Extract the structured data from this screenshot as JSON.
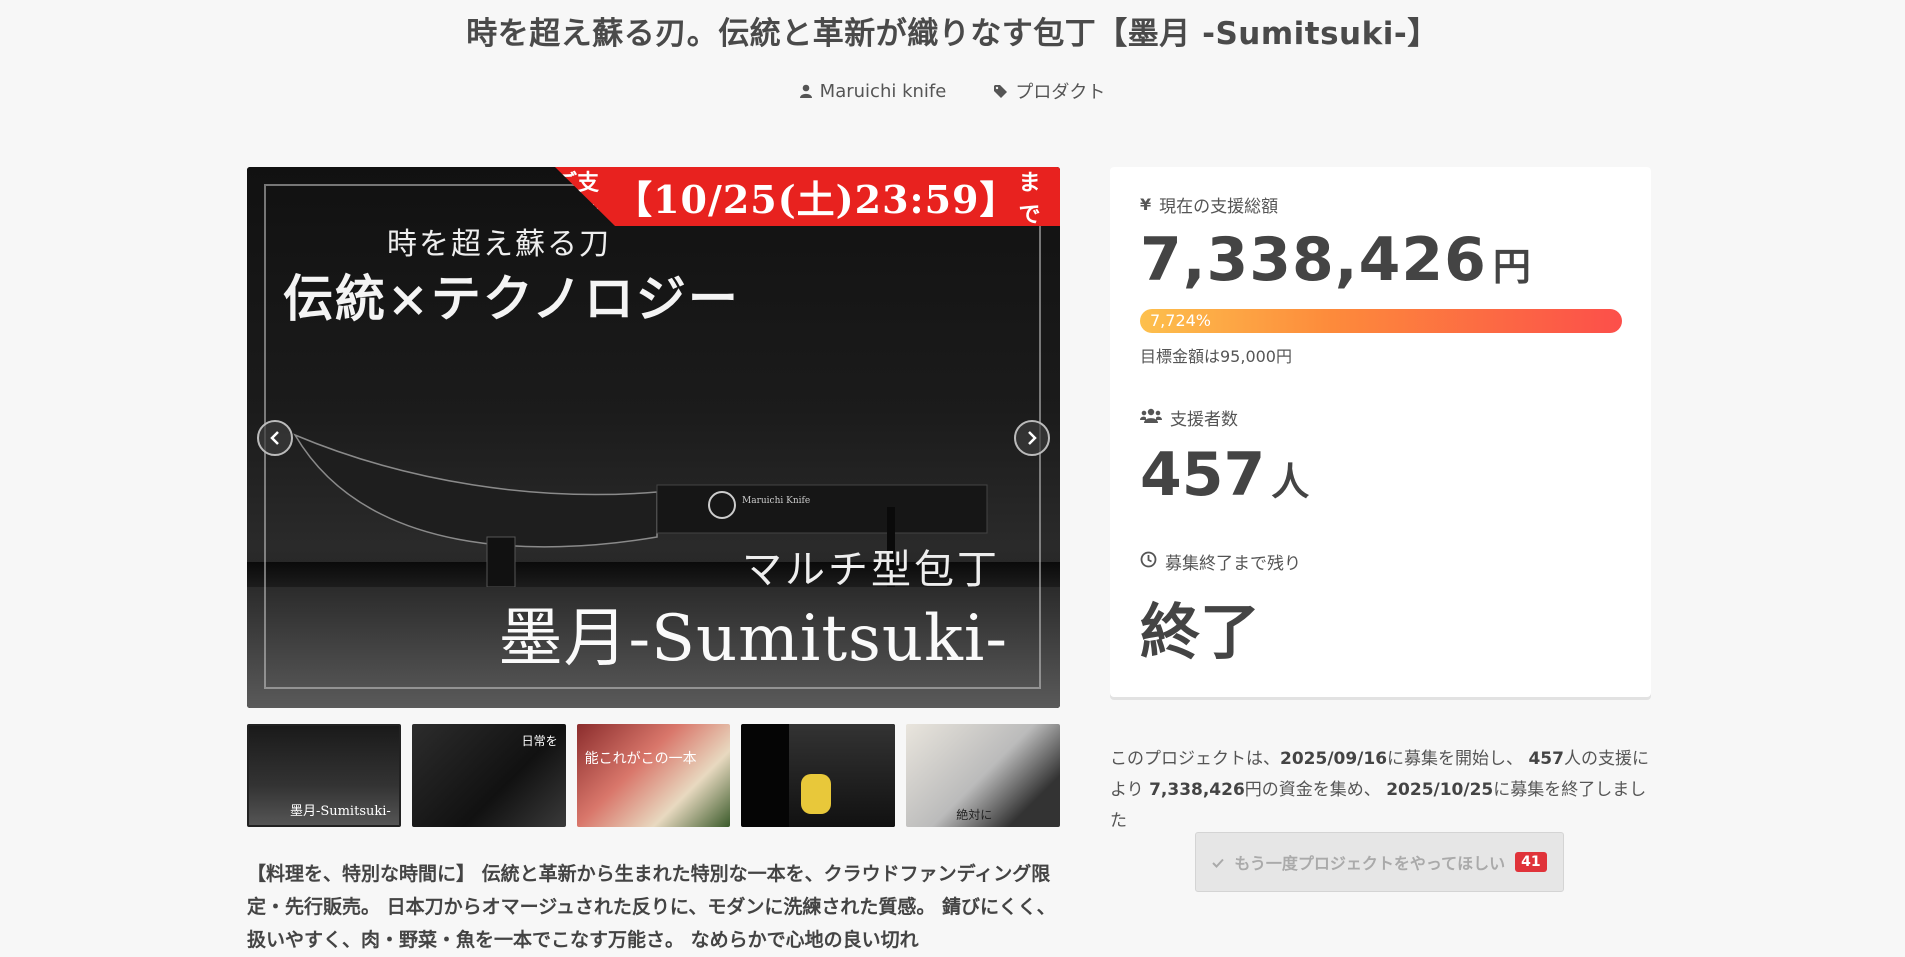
{
  "project": {
    "title": "時を超え蘇る刃。伝統と革新が織りなす包丁【墨月 -Sumitsuki-】",
    "owner": "Maruichi knife",
    "category": "プロダクト"
  },
  "main_image": {
    "banner_prefix": "ご支援は",
    "banner_date": "【10/25(土)23:59】",
    "banner_suffix": "まで",
    "line1": "時を超え蘇る刀",
    "line2": "伝統×テクノロジー",
    "line3": "マルチ型包丁",
    "line4": "墨月-Sumitsuki-",
    "knife_brand": "Maruichi Knife"
  },
  "thumbnails": [
    {
      "caption": "墨月-Sumitsuki-"
    },
    {
      "caption": "日常を"
    },
    {
      "caption": "能これがこの一本"
    },
    {
      "caption": ""
    },
    {
      "caption": "絶対に"
    }
  ],
  "description": "【料理を、特別な時間に】 伝統と革新から生まれた特別な一本を、クラウドファンディング限定・先行販売。 日本刀からオマージュされた反りに、モダンに洗練された質感。 錆びにくく、扱いやすく、肉・野菜・魚を一本でこなす万能さ。 なめらかで心地の良い切れ",
  "panel": {
    "raised_label": "現在の支援総額",
    "raised_amount": "7,338,426",
    "raised_unit": "円",
    "progress_percent": "7,724%",
    "progress_fraction": 1.0,
    "goal_text": "目標金額は95,000円",
    "backers_label": "支援者数",
    "backers_count": "457",
    "backers_unit": "人",
    "time_label": "募集終了まで残り",
    "time_value": "終了"
  },
  "summary": {
    "p1": "このプロジェクトは、",
    "start_date": "2025/09/16",
    "p2": "に募集を開始し、 ",
    "backers": "457",
    "p3": "人の支援により ",
    "amount": "7,338,426",
    "p4": "円の資金を集め、 ",
    "end_date": "2025/10/25",
    "p5": "に募集を終了しました"
  },
  "again_button": {
    "label": "もう一度プロジェクトをやってほしい",
    "count": "41"
  },
  "colors": {
    "accent_red": "#e8221f",
    "progress_start": "#fdc04d",
    "progress_end": "#fc4f4a",
    "badge_red": "#e0333a"
  }
}
